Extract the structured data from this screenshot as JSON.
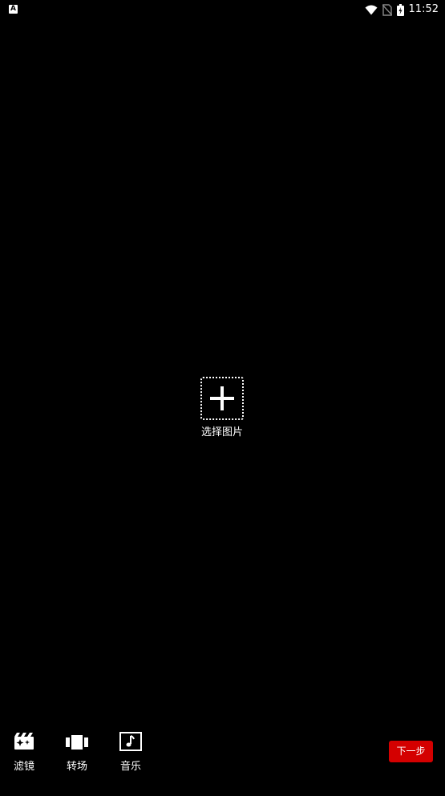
{
  "status_bar": {
    "left_icon": "A",
    "time": "11:52",
    "icons": [
      "wifi-icon",
      "no-sim-icon",
      "battery-charging-icon"
    ]
  },
  "picker": {
    "icon": "plus-icon",
    "label": "选择图片"
  },
  "toolbar": {
    "items": [
      {
        "icon": "filter-icon",
        "label": "滤镜"
      },
      {
        "icon": "transition-icon",
        "label": "转场"
      },
      {
        "icon": "music-icon",
        "label": "音乐"
      }
    ],
    "next_label": "下一步"
  },
  "colors": {
    "background": "#000000",
    "accent": "#d40000",
    "foreground": "#ffffff"
  }
}
